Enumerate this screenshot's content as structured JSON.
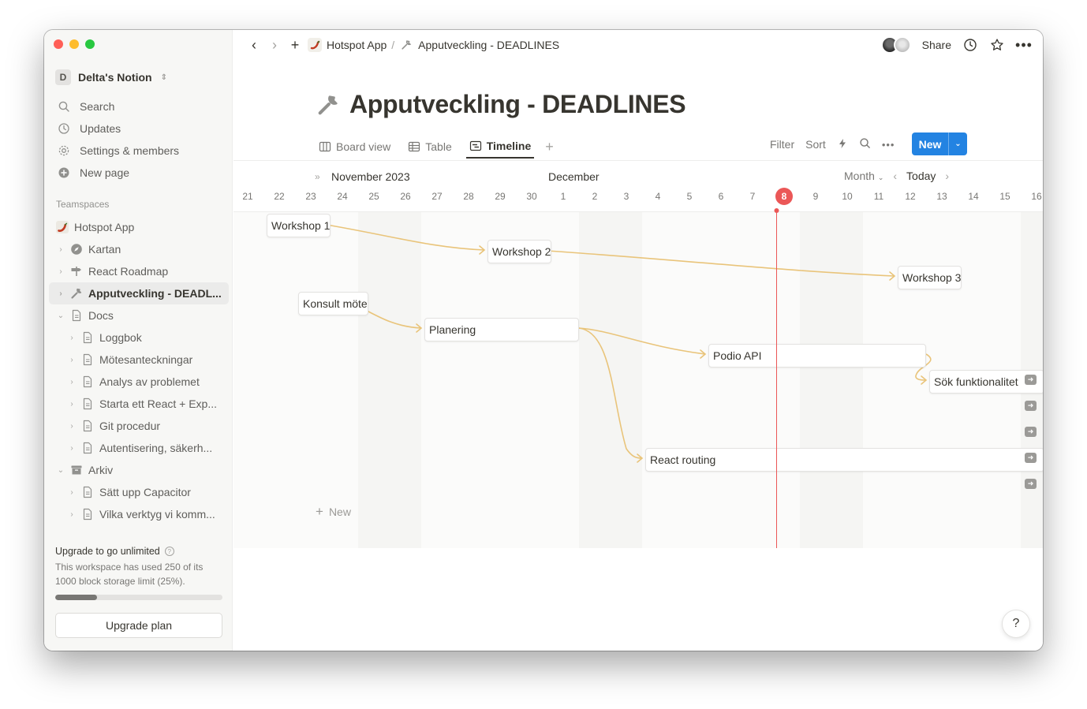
{
  "sidebar": {
    "workspace_initial": "D",
    "workspace_name": "Delta's Notion",
    "nav": [
      {
        "label": "Search",
        "icon": "search-icon"
      },
      {
        "label": "Updates",
        "icon": "clock-icon"
      },
      {
        "label": "Settings & members",
        "icon": "gear-icon"
      },
      {
        "label": "New page",
        "icon": "plus-circle-icon"
      }
    ],
    "teamspaces_label": "Teamspaces",
    "tree": [
      {
        "label": "Hotspot App",
        "icon": "chili-icon",
        "level": 0,
        "chevron": ""
      },
      {
        "label": "Kartan",
        "icon": "compass-icon",
        "level": 1,
        "chevron": "›"
      },
      {
        "label": "React Roadmap",
        "icon": "signpost-icon",
        "level": 1,
        "chevron": "›"
      },
      {
        "label": "Apputveckling - DEADL...",
        "icon": "wrench-icon",
        "level": 1,
        "chevron": "›",
        "active": true
      },
      {
        "label": "Docs",
        "icon": "document-icon",
        "level": 1,
        "chevron": "⌄"
      },
      {
        "label": "Loggbok",
        "icon": "document-icon",
        "level": 2,
        "chevron": "›"
      },
      {
        "label": "Mötesanteckningar",
        "icon": "document-icon",
        "level": 2,
        "chevron": "›"
      },
      {
        "label": "Analys av problemet",
        "icon": "document-icon",
        "level": 2,
        "chevron": "›"
      },
      {
        "label": "Starta ett React + Exp...",
        "icon": "document-icon",
        "level": 2,
        "chevron": "›"
      },
      {
        "label": "Git procedur",
        "icon": "document-icon",
        "level": 2,
        "chevron": "›"
      },
      {
        "label": "Autentisering, säkerh...",
        "icon": "document-icon",
        "level": 2,
        "chevron": "›"
      },
      {
        "label": "Arkiv",
        "icon": "archive-icon",
        "level": 1,
        "chevron": "⌄"
      },
      {
        "label": "Sätt upp Capacitor",
        "icon": "document-icon",
        "level": 2,
        "chevron": "›"
      },
      {
        "label": "Vilka verktyg vi komm...",
        "icon": "document-icon",
        "level": 2,
        "chevron": "›"
      }
    ],
    "upgrade": {
      "title": "Upgrade to go unlimited",
      "text": "This workspace has used 250 of its 1000 block storage limit (25%).",
      "progress": 0.25,
      "button": "Upgrade plan"
    }
  },
  "topbar": {
    "crumb_1": "Hotspot App",
    "crumb_sep": "/",
    "crumb_2": "Apputveckling - DEADLINES",
    "share": "Share"
  },
  "page": {
    "title": "Apputveckling - DEADLINES",
    "views": [
      {
        "label": "Board view",
        "icon": "board-icon"
      },
      {
        "label": "Table",
        "icon": "table-icon"
      },
      {
        "label": "Timeline",
        "icon": "timeline-icon",
        "active": true
      }
    ],
    "tools": {
      "filter": "Filter",
      "sort": "Sort"
    },
    "new_button": "New"
  },
  "timeline": {
    "month_1": "November 2023",
    "month_2": "December",
    "scale": "Month",
    "today_label": "Today",
    "days": [
      "21",
      "22",
      "23",
      "24",
      "25",
      "26",
      "27",
      "28",
      "29",
      "30",
      "1",
      "2",
      "3",
      "4",
      "5",
      "6",
      "7",
      "8",
      "9",
      "10",
      "11",
      "12",
      "13",
      "14",
      "15",
      "16"
    ],
    "today_index": 17,
    "items": [
      {
        "label": "Workshop 1",
        "start_index": 0
      },
      {
        "label": "Workshop 2",
        "start_index": 7
      },
      {
        "label": "Workshop 3",
        "start_index": 20
      },
      {
        "label": "Konsult möte",
        "start_index": 1
      },
      {
        "label": "Planering",
        "start_index": 6
      },
      {
        "label": "Podio API",
        "start_index": 15
      },
      {
        "label": "Sök funktionalitet",
        "start_index": 22
      },
      {
        "label": "React routing",
        "start_index": 13
      }
    ],
    "add_new": "New"
  },
  "colors": {
    "accent": "#2383e2",
    "today": "#eb5757",
    "dependency": "#e9c47a"
  }
}
